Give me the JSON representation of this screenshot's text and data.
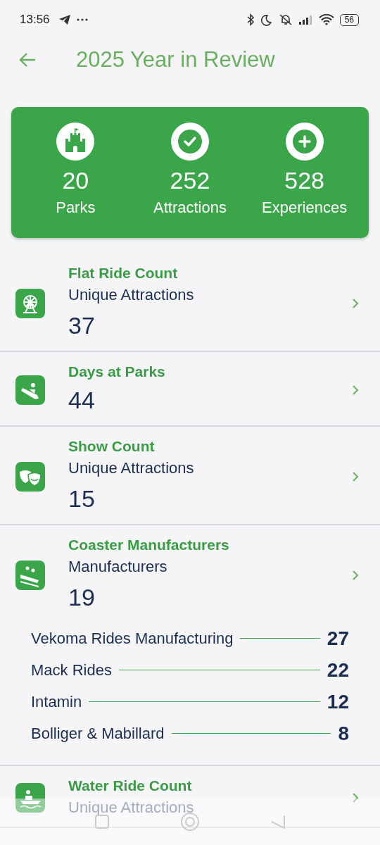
{
  "status_bar": {
    "time": "13:56",
    "battery": "56"
  },
  "header": {
    "title": "2025 Year in Review"
  },
  "summary": [
    {
      "kind": "parks",
      "value": "20",
      "label": "Parks"
    },
    {
      "kind": "attractions",
      "value": "252",
      "label": "Attractions"
    },
    {
      "kind": "experiences",
      "value": "528",
      "label": "Experiences"
    }
  ],
  "stats": [
    {
      "kind": "flat",
      "title": "Flat Ride Count",
      "subtitle": "Unique Attractions",
      "value": "37"
    },
    {
      "kind": "days",
      "title": "Days at Parks",
      "value": "44"
    },
    {
      "kind": "show",
      "title": "Show Count",
      "subtitle": "Unique Attractions",
      "value": "15"
    },
    {
      "kind": "coaster",
      "title": "Coaster Manufacturers",
      "subtitle": "Manufacturers",
      "value": "19",
      "breakdown": [
        {
          "name": "Vekoma Rides Manufacturing",
          "count": "27"
        },
        {
          "name": "Mack Rides",
          "count": "22"
        },
        {
          "name": "Intamin",
          "count": "12"
        },
        {
          "name": "Bolliger & Mabillard",
          "count": "8"
        }
      ]
    },
    {
      "kind": "water",
      "title": "Water Ride Count",
      "subtitle": "Unique Attractions"
    }
  ]
}
